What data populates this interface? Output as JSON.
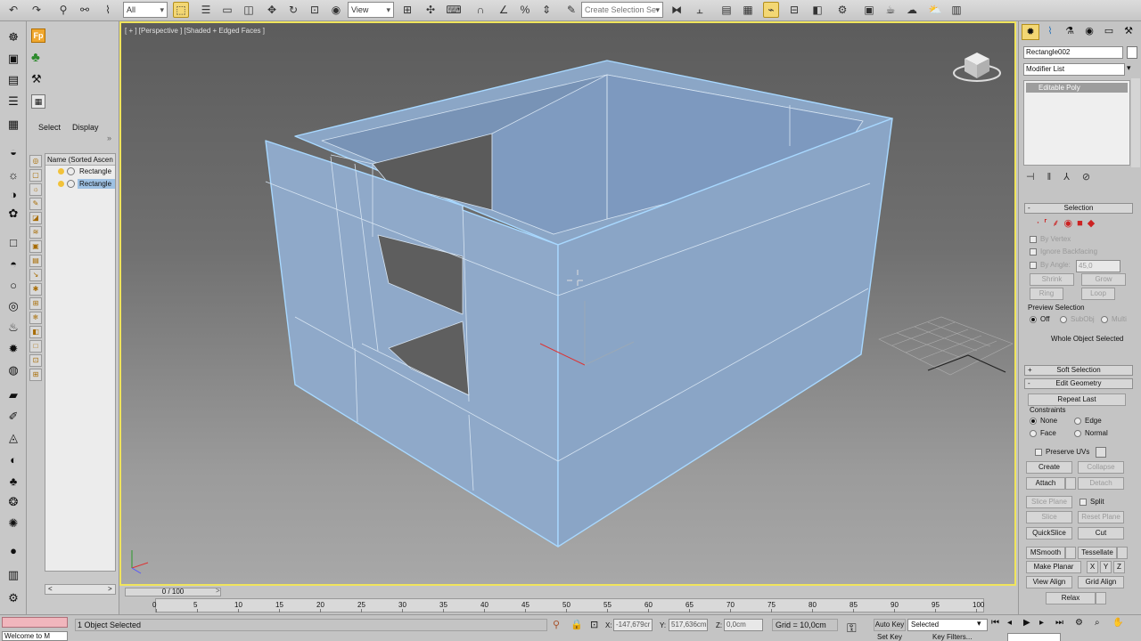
{
  "toolbar": {
    "selection_filter": "All",
    "reference_coord": "View",
    "named_selection_placeholder": "Create Selection Se"
  },
  "scene_explorer": {
    "tabs": [
      "Select",
      "Display"
    ],
    "header": "Name (Sorted Ascen",
    "items": [
      "Rectangle",
      "Rectangle"
    ],
    "scroll_left": "<",
    "scroll_right": ">"
  },
  "viewport": {
    "label": "[ + ] [Perspective ] [Shaded + Edged Faces ]",
    "colors": {
      "object_fill": "#8fa9c9",
      "object_edge": "#a8d8ff",
      "wire": "#d6e4f2"
    }
  },
  "command_panel": {
    "object_name": "Rectangle002",
    "modifier_list": "Modifier List",
    "stack_item": "Editable Poly",
    "selection": {
      "title": "Selection",
      "by_vertex": "By Vertex",
      "ignore_backfacing": "Ignore Backfacing",
      "by_angle": "By Angle:",
      "angle_value": "45,0",
      "shrink": "Shrink",
      "grow": "Grow",
      "ring": "Ring",
      "loop": "Loop",
      "preview_selection": "Preview Selection",
      "off": "Off",
      "subobj": "SubObj",
      "multi": "Multi",
      "status": "Whole Object Selected"
    },
    "soft_selection": "Soft Selection",
    "edit_geometry": {
      "title": "Edit Geometry",
      "repeat_last": "Repeat Last",
      "constraints": "Constraints",
      "none": "None",
      "edge": "Edge",
      "face": "Face",
      "normal": "Normal",
      "preserve_uvs": "Preserve UVs",
      "create": "Create",
      "collapse": "Collapse",
      "attach": "Attach",
      "detach": "Detach",
      "slice_plane": "Slice Plane",
      "split": "Split",
      "slice": "Slice",
      "reset_plane": "Reset Plane",
      "quickslice": "QuickSlice",
      "cut": "Cut",
      "msmooth": "MSmooth",
      "tessellate": "Tessellate",
      "make_planar": "Make Planar",
      "x": "X",
      "y": "Y",
      "z": "Z",
      "view_align": "View Align",
      "grid_align": "Grid Align",
      "relax": "Relax"
    }
  },
  "timeline": {
    "frame": "0 / 100",
    "ticks": [
      "0",
      "5",
      "10",
      "15",
      "20",
      "25",
      "30",
      "35",
      "40",
      "45",
      "50",
      "55",
      "60",
      "65",
      "70",
      "75",
      "80",
      "85",
      "90",
      "95",
      "100"
    ]
  },
  "status": {
    "selection_status": "1 Object Selected",
    "welcome": "Welcome to M",
    "x_label": "X:",
    "x_value": "-147,679cr",
    "y_label": "Y:",
    "y_value": "517,636cm",
    "z_label": "Z:",
    "z_value": "0,0cm",
    "grid": "Grid = 10,0cm",
    "auto_key": "Auto Key",
    "set_key": "Set Key",
    "key_mode": "Selected",
    "key_filters": "Key Filters..."
  }
}
